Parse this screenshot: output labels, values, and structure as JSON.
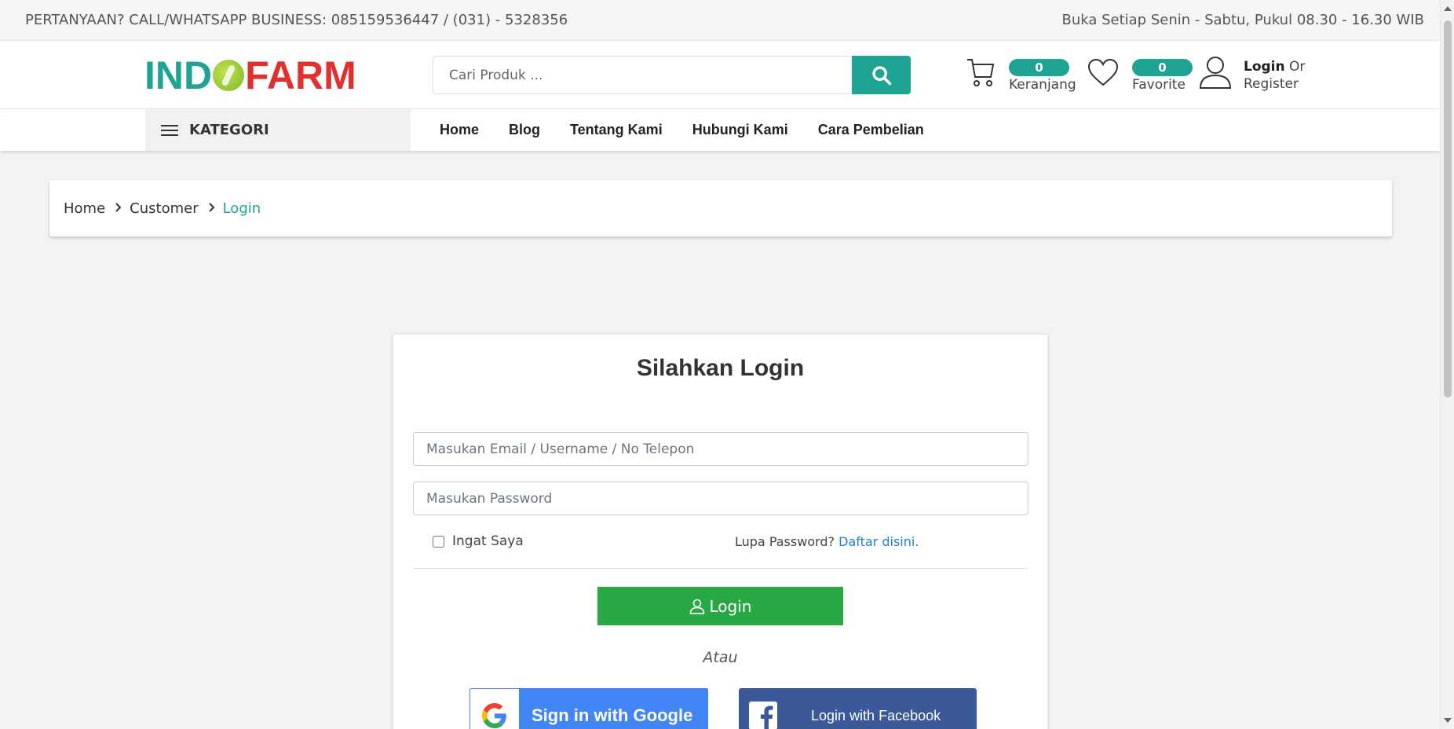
{
  "topbar": {
    "contact": "PERTANYAAN? CALL/WHATSAPP BUSINESS: 085159536447 / (031) - 5328356",
    "hours": "Buka Setiap Senin - Sabtu, Pukul 08.30 - 16.30 WIB"
  },
  "header": {
    "logo_left": "IND",
    "logo_right": "FARM",
    "search_placeholder": "Cari Produk ...",
    "cart_count": "0",
    "cart_label": "Keranjang",
    "fav_count": "0",
    "fav_label": "Favorite",
    "login_label": "Login",
    "or_label": "Or",
    "register_label": "Register"
  },
  "nav": {
    "kategori": "KATEGORI",
    "items": [
      "Home",
      "Blog",
      "Tentang Kami",
      "Hubungi Kami",
      "Cara Pembelian"
    ]
  },
  "breadcrumb": [
    "Home",
    "Customer",
    "Login"
  ],
  "login": {
    "title": "Silahkan Login",
    "email_placeholder": "Masukan Email / Username / No Telepon",
    "password_placeholder": "Masukan Password",
    "remember": "Ingat Saya",
    "forgot": "Lupa Password?",
    "register_link": "Daftar disini.",
    "login_button": "Login",
    "or": "Atau",
    "google_button": "Sign in with Google",
    "facebook_login": "Login",
    "facebook_with": "with",
    "facebook_brand": "Facebook"
  },
  "colors": {
    "brand": "#1fa393",
    "logo_red": "#e0312e",
    "login_green": "#28a745",
    "google_blue": "#4285f4",
    "facebook_blue": "#3b5998",
    "link_blue": "#1f7fd4"
  }
}
